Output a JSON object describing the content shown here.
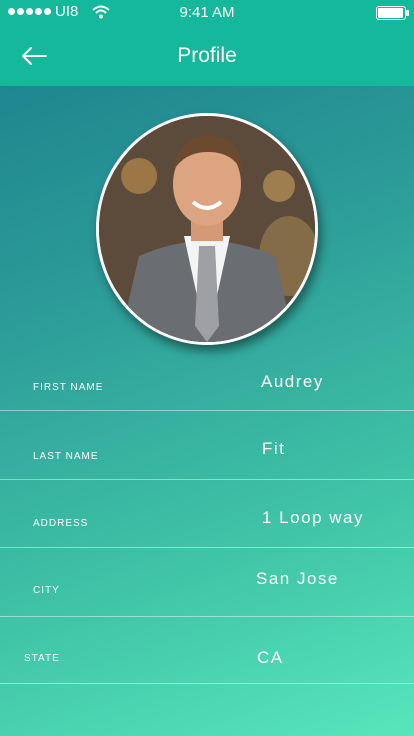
{
  "status": {
    "carrier": "UI8",
    "time": "9:41 AM"
  },
  "header": {
    "title": "Profile"
  },
  "profile": {
    "fields": [
      {
        "label": "FIRST NAME",
        "value": "Audrey"
      },
      {
        "label": "LAST NAME",
        "value": "Fit"
      },
      {
        "label": "ADDRESS",
        "value": "1 Loop way"
      },
      {
        "label": "CITY",
        "value": "San Jose"
      },
      {
        "label": "STATE",
        "value": "CA"
      }
    ]
  },
  "colors": {
    "header": "#16b89c",
    "gradient_start": "#1a7f8c",
    "gradient_end": "#57e6bb"
  }
}
